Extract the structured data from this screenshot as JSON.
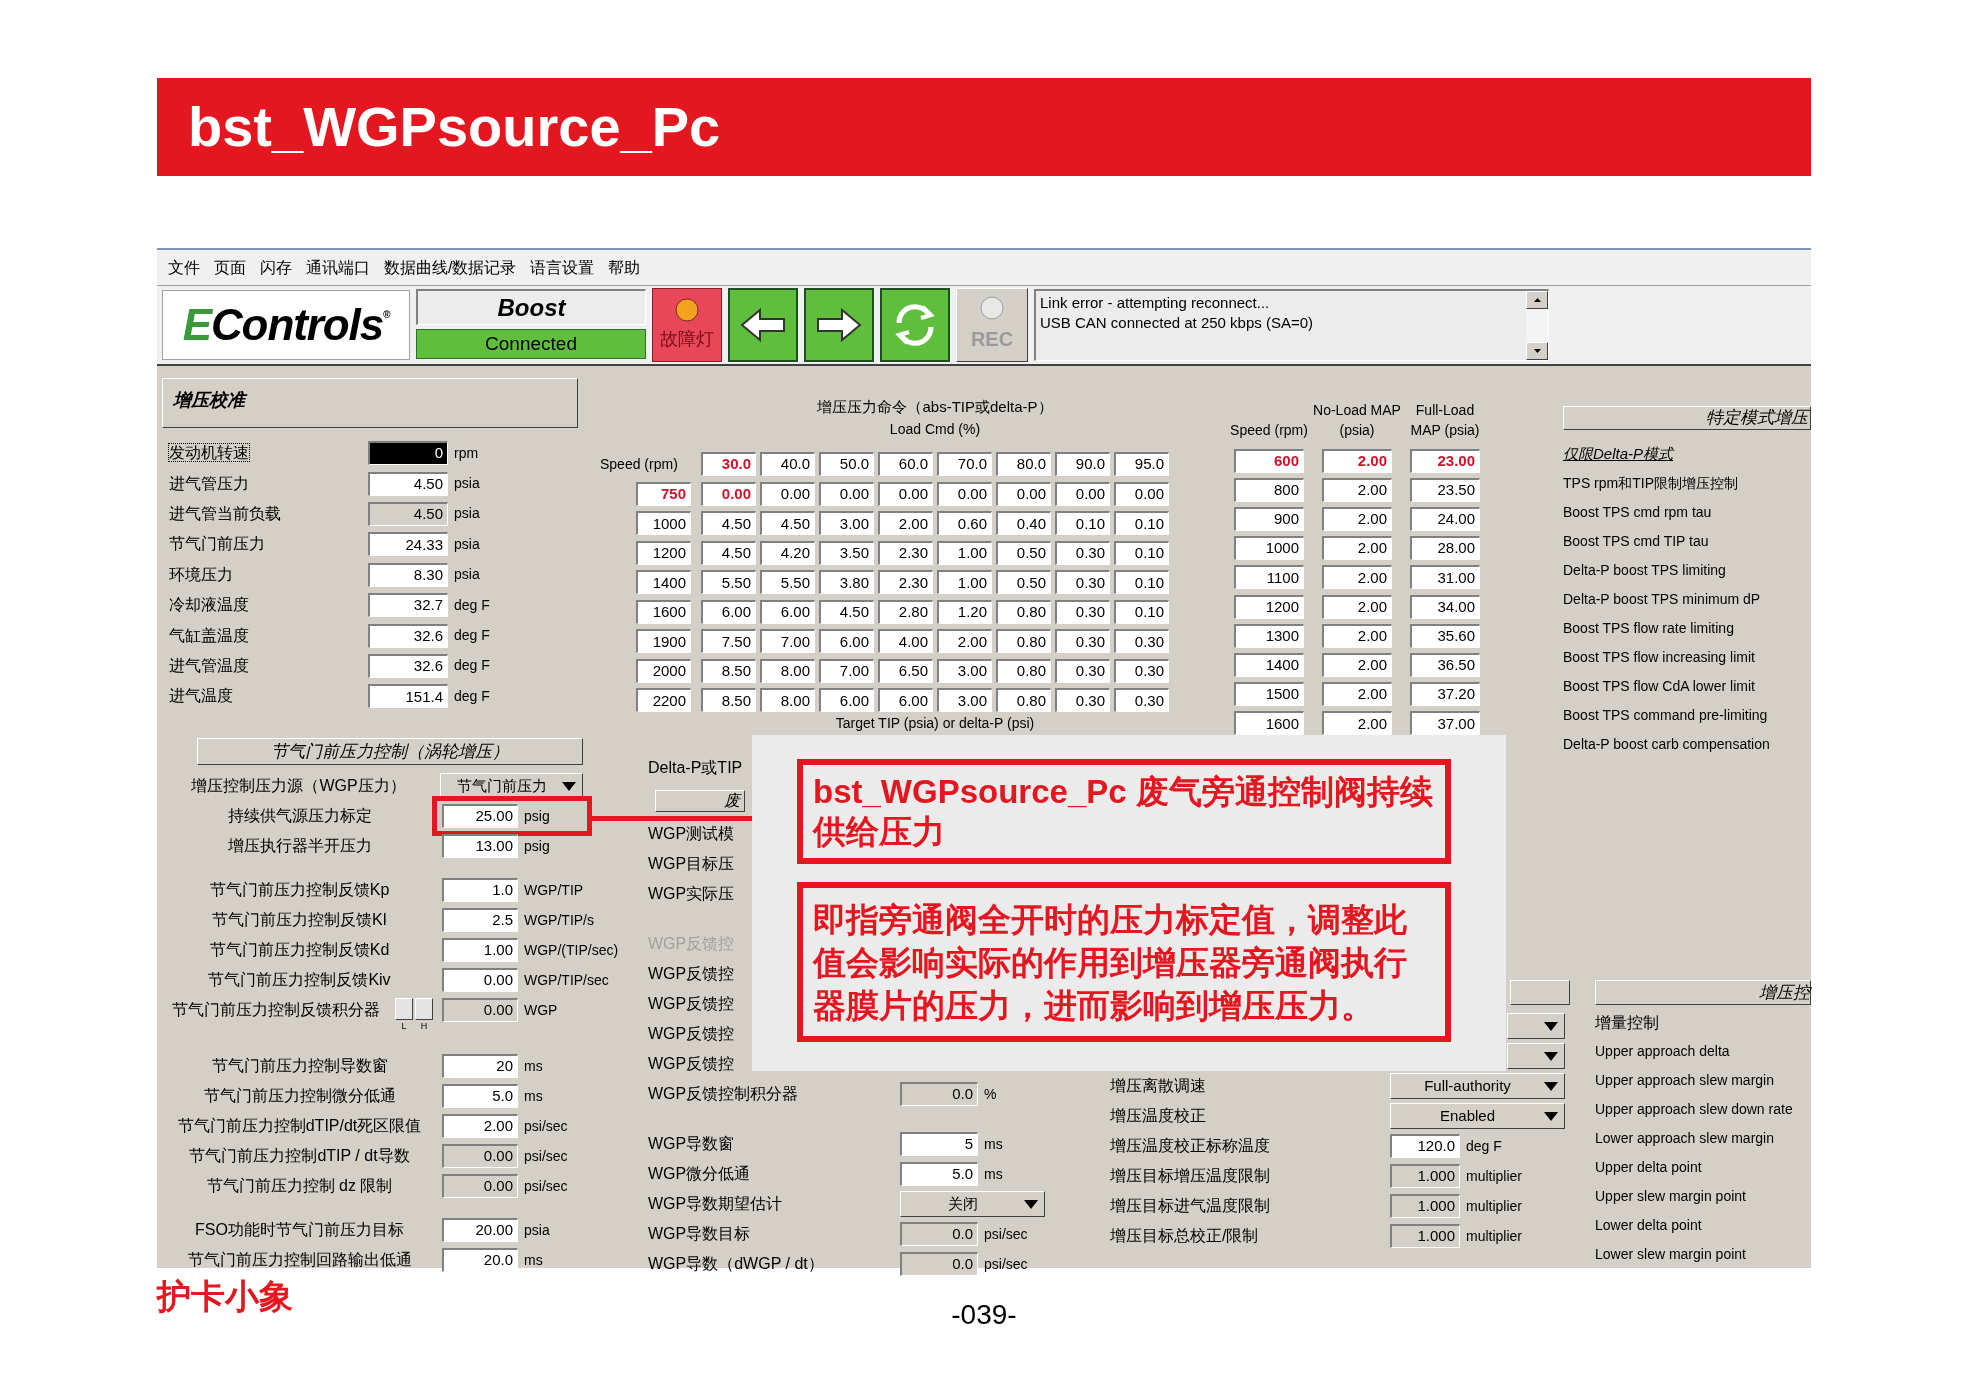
{
  "header": {
    "title": "bst_WGPsource_Pc"
  },
  "menu": [
    "文件",
    "页面",
    "闪存",
    "通讯端口",
    "数据曲线/数据记录",
    "语言设置",
    "帮助"
  ],
  "toolbar": {
    "logo": {
      "mark": "E",
      "name": "Controls",
      "registered": "®"
    },
    "device": "Boost",
    "status": "Connected",
    "fault_lamp": {
      "label": "故障灯",
      "on": true
    },
    "rec": {
      "label": "REC",
      "disabled": true
    },
    "log": [
      "Link error - attempting reconnect...",
      "USB CAN connected at 250 kbps (SA=0)"
    ]
  },
  "calibration": {
    "title": "增压校准",
    "rows": [
      {
        "label": "发动机转速",
        "value": "0",
        "unit": "rpm",
        "focused": true,
        "readonly": false
      },
      {
        "label": "进气管压力",
        "value": "4.50",
        "unit": "psia",
        "focused": false,
        "readonly": false
      },
      {
        "label": "进气管当前负载",
        "value": "4.50",
        "unit": "psia",
        "focused": false,
        "readonly": true
      },
      {
        "label": "节气门前压力",
        "value": "24.33",
        "unit": "psia",
        "focused": false,
        "readonly": false
      },
      {
        "label": "环境压力",
        "value": "8.30",
        "unit": "psia",
        "focused": false,
        "readonly": false
      },
      {
        "label": "冷却液温度",
        "value": "32.7",
        "unit": "deg F",
        "focused": false,
        "readonly": false
      },
      {
        "label": "气缸盖温度",
        "value": "32.6",
        "unit": "deg F",
        "focused": false,
        "readonly": false
      },
      {
        "label": "进气管温度",
        "value": "32.6",
        "unit": "deg F",
        "focused": false,
        "readonly": false
      },
      {
        "label": "进气温度",
        "value": "151.4",
        "unit": "deg F",
        "focused": false,
        "readonly": false
      }
    ]
  },
  "boost_table": {
    "title": "增压压力命令（abs-TIP或delta-P）",
    "column_axis": "Load Cmd (%)",
    "row_axis": "Speed (rpm)",
    "footer": "Target TIP (psia) or delta-P (psi)",
    "columns": [
      {
        "label": "30.0",
        "active": true
      },
      {
        "label": "40.0",
        "active": false
      },
      {
        "label": "50.0",
        "active": false
      },
      {
        "label": "60.0",
        "active": false
      },
      {
        "label": "70.0",
        "active": false
      },
      {
        "label": "80.0",
        "active": false
      },
      {
        "label": "90.0",
        "active": false
      },
      {
        "label": "95.0",
        "active": false
      }
    ],
    "rows": [
      {
        "speed": "750",
        "active": true,
        "values": [
          "0.00",
          "0.00",
          "0.00",
          "0.00",
          "0.00",
          "0.00",
          "0.00",
          "0.00"
        ]
      },
      {
        "speed": "1000",
        "active": false,
        "values": [
          "4.50",
          "4.50",
          "3.00",
          "2.00",
          "0.60",
          "0.40",
          "0.10",
          "0.10"
        ]
      },
      {
        "speed": "1200",
        "active": false,
        "values": [
          "4.50",
          "4.20",
          "3.50",
          "2.30",
          "1.00",
          "0.50",
          "0.30",
          "0.10"
        ]
      },
      {
        "speed": "1400",
        "active": false,
        "values": [
          "5.50",
          "5.50",
          "3.80",
          "2.30",
          "1.00",
          "0.50",
          "0.30",
          "0.10"
        ]
      },
      {
        "speed": "1600",
        "active": false,
        "values": [
          "6.00",
          "6.00",
          "4.50",
          "2.80",
          "1.20",
          "0.80",
          "0.30",
          "0.10"
        ]
      },
      {
        "speed": "1900",
        "active": false,
        "values": [
          "7.50",
          "7.00",
          "6.00",
          "4.00",
          "2.00",
          "0.80",
          "0.30",
          "0.30"
        ]
      },
      {
        "speed": "2000",
        "active": false,
        "values": [
          "8.50",
          "8.00",
          "7.00",
          "6.50",
          "3.00",
          "0.80",
          "0.30",
          "0.30"
        ]
      },
      {
        "speed": "2200",
        "active": false,
        "values": [
          "8.50",
          "8.00",
          "6.00",
          "6.00",
          "3.00",
          "0.80",
          "0.30",
          "0.30"
        ]
      }
    ]
  },
  "map_table": {
    "columns": [
      "Speed (rpm)",
      "No-Load MAP (psia)",
      "Full-Load MAP (psia)"
    ],
    "rows": [
      {
        "cells": [
          "600",
          "2.00",
          "23.00"
        ],
        "active": true
      },
      {
        "cells": [
          "800",
          "2.00",
          "23.50"
        ],
        "active": false
      },
      {
        "cells": [
          "900",
          "2.00",
          "24.00"
        ],
        "active": false
      },
      {
        "cells": [
          "1000",
          "2.00",
          "28.00"
        ],
        "active": false
      },
      {
        "cells": [
          "1100",
          "2.00",
          "31.00"
        ],
        "active": false
      },
      {
        "cells": [
          "1200",
          "2.00",
          "34.00"
        ],
        "active": false
      },
      {
        "cells": [
          "1300",
          "2.00",
          "35.60"
        ],
        "active": false
      },
      {
        "cells": [
          "1400",
          "2.00",
          "36.50"
        ],
        "active": false
      },
      {
        "cells": [
          "1500",
          "2.00",
          "37.20"
        ],
        "active": false
      },
      {
        "cells": [
          "1600",
          "2.00",
          "37.00"
        ],
        "active": false
      }
    ]
  },
  "mode_panel": {
    "title": "特定模式增压",
    "items": [
      {
        "kind": "heading",
        "text": "仅限Delta-P模式"
      },
      {
        "kind": "item",
        "text": "TPS rpm和TIP限制增压控制"
      },
      {
        "kind": "item",
        "text": "Boost TPS cmd rpm tau"
      },
      {
        "kind": "item",
        "text": "Boost TPS cmd TIP tau"
      },
      {
        "kind": "item",
        "text": "Delta-P boost TPS limiting"
      },
      {
        "kind": "item",
        "text": "Delta-P boost TPS minimum dP"
      },
      {
        "kind": "item",
        "text": "Boost TPS flow rate limiting"
      },
      {
        "kind": "item",
        "text": "Boost TPS flow increasing limit"
      },
      {
        "kind": "item",
        "text": "Boost TPS flow CdA lower limit"
      },
      {
        "kind": "item",
        "text": "Boost TPS command pre-limiting"
      },
      {
        "kind": "item",
        "text": "Delta-P boost carb compensation"
      }
    ]
  },
  "throttle_panel": {
    "title": "节气门前压力控制（涡轮增压）",
    "groups": [
      {
        "rows": [
          {
            "kind": "select",
            "label": "增压控制压力源（WGP压力）",
            "value": "节气门前压力"
          },
          {
            "kind": "field",
            "label": "持续供气源压力标定",
            "value": "25.00",
            "unit": "psig",
            "readonly": false,
            "highlighted": true
          },
          {
            "kind": "field",
            "label": "增压执行器半开压力",
            "value": "13.00",
            "unit": "psig",
            "readonly": false,
            "highlighted": false
          }
        ]
      },
      {
        "rows": [
          {
            "kind": "field",
            "label": "节气门前压力控制反馈Kp",
            "value": "1.0",
            "unit": "WGP/TIP",
            "readonly": false,
            "highlighted": false
          },
          {
            "kind": "field",
            "label": "节气门前压力控制反馈KI",
            "value": "2.5",
            "unit": "WGP/TIP/s",
            "readonly": false,
            "highlighted": false
          },
          {
            "kind": "field",
            "label": "节气门前压力控制反馈Kd",
            "value": "1.00",
            "unit": "WGP/(TIP/sec)",
            "readonly": false,
            "highlighted": false
          },
          {
            "kind": "field",
            "label": "节气门前压力控制反馈Kiv",
            "value": "0.00",
            "unit": "WGP/TIP/sec",
            "readonly": false,
            "highlighted": false
          },
          {
            "kind": "integrator",
            "label": "节气门前压力控制反馈积分器",
            "value": "0.00",
            "unit": "WGP",
            "readonly": true,
            "highlighted": false,
            "buttons": [
              "L",
              "H"
            ]
          }
        ]
      },
      {
        "rows": [
          {
            "kind": "field",
            "label": "节气门前压力控制导数窗",
            "value": "20",
            "unit": "ms",
            "readonly": false,
            "highlighted": false
          },
          {
            "kind": "field",
            "label": "节气门前压力控制微分低通",
            "value": "5.0",
            "unit": "ms",
            "readonly": false,
            "highlighted": false
          },
          {
            "kind": "field",
            "label": "节气门前压力控制dTIP/dt死区限值",
            "value": "2.00",
            "unit": "psi/sec",
            "readonly": false,
            "highlighted": false
          },
          {
            "kind": "field",
            "label": "节气门前压力控制dTIP / dt导数",
            "value": "0.00",
            "unit": "psi/sec",
            "readonly": true,
            "highlighted": false
          },
          {
            "kind": "field",
            "label": "节气门前压力控制 dz 限制",
            "value": "0.00",
            "unit": "psi/sec",
            "readonly": true,
            "highlighted": false
          }
        ]
      },
      {
        "rows": [
          {
            "kind": "field",
            "label": "FSO功能时节气门前压力目标",
            "value": "20.00",
            "unit": "psia",
            "readonly": false,
            "highlighted": false
          },
          {
            "kind": "field",
            "label": "节气门前压力控制回路输出低通",
            "value": "20.0",
            "unit": "ms",
            "readonly": false,
            "highlighted": false
          }
        ]
      }
    ]
  },
  "wgp_panel": {
    "groups": [
      {
        "rows": [
          {
            "kind": "label",
            "text": "Delta-P或TIP",
            "disabled": false
          },
          {
            "kind": "group",
            "text": "废"
          },
          {
            "kind": "label",
            "text": "WGP测试模",
            "disabled": false
          },
          {
            "kind": "label",
            "text": "WGP目标压",
            "disabled": false
          },
          {
            "kind": "label",
            "text": "WGP实际压",
            "disabled": false
          }
        ]
      },
      {
        "rows": [
          {
            "kind": "label",
            "text": "WGP反馈控",
            "disabled": true
          },
          {
            "kind": "label",
            "text": "WGP反馈控",
            "disabled": false
          },
          {
            "kind": "label",
            "text": "WGP反馈控",
            "disabled": false
          },
          {
            "kind": "label",
            "text": "WGP反馈控",
            "disabled": false
          },
          {
            "kind": "label",
            "text": "WGP反馈控",
            "disabled": false
          },
          {
            "kind": "field",
            "label": "WGP反馈控制积分器",
            "value": "0.0",
            "unit": "%",
            "readonly": true
          }
        ]
      },
      {
        "rows": [
          {
            "kind": "field",
            "label": "WGP导数窗",
            "value": "5",
            "unit": "ms",
            "readonly": false
          },
          {
            "kind": "field",
            "label": "WGP微分低通",
            "value": "5.0",
            "unit": "ms",
            "readonly": false
          },
          {
            "kind": "select",
            "label": "WGP导数期望估计",
            "value": "关闭"
          },
          {
            "kind": "field",
            "label": "WGP导数目标",
            "value": "0.0",
            "unit": "psi/sec",
            "readonly": true
          },
          {
            "kind": "field",
            "label": "WGP导数（dWGP / dt）",
            "value": "0.0",
            "unit": "psi/sec",
            "readonly": true
          }
        ]
      }
    ]
  },
  "temperature_panel": {
    "rows": [
      {
        "kind": "select"
      },
      {
        "kind": "select"
      },
      {
        "kind": "select",
        "label": "增压离散调速",
        "value": "Full-authority"
      },
      {
        "kind": "select",
        "label": "增压温度校正",
        "value": "Enabled"
      },
      {
        "kind": "field",
        "label": "增压温度校正标称温度",
        "value": "120.0",
        "unit": "deg F",
        "readonly": false
      },
      {
        "kind": "field",
        "label": "增压目标增压温度限制",
        "value": "1.000",
        "unit": "multiplier",
        "readonly": true
      },
      {
        "kind": "field",
        "label": "增压目标进气温度限制",
        "value": "1.000",
        "unit": "multiplier",
        "readonly": true
      },
      {
        "kind": "field",
        "label": "增压目标总校正/限制",
        "value": "1.000",
        "unit": "multiplier",
        "readonly": true
      }
    ]
  },
  "boost_control_panel": {
    "title": "增压控",
    "items": [
      "增量控制",
      "Upper approach delta",
      "Upper approach slew margin",
      "Upper approach slew down rate",
      "Lower approach slew margin",
      "Upper delta point",
      "Upper slew margin point",
      "Lower delta point",
      "Lower slew margin point"
    ]
  },
  "annotation": {
    "title": "bst_WGPsource_Pc 废气旁通控制阀持续供给压力",
    "body": "即指旁通阀全开时的压力标定值，调整此值会影响实际的作用到增压器旁通阀执行器膜片的压力，进而影响到增压压力。"
  },
  "footer": {
    "brand": "护卡小象",
    "page": "-039-"
  }
}
